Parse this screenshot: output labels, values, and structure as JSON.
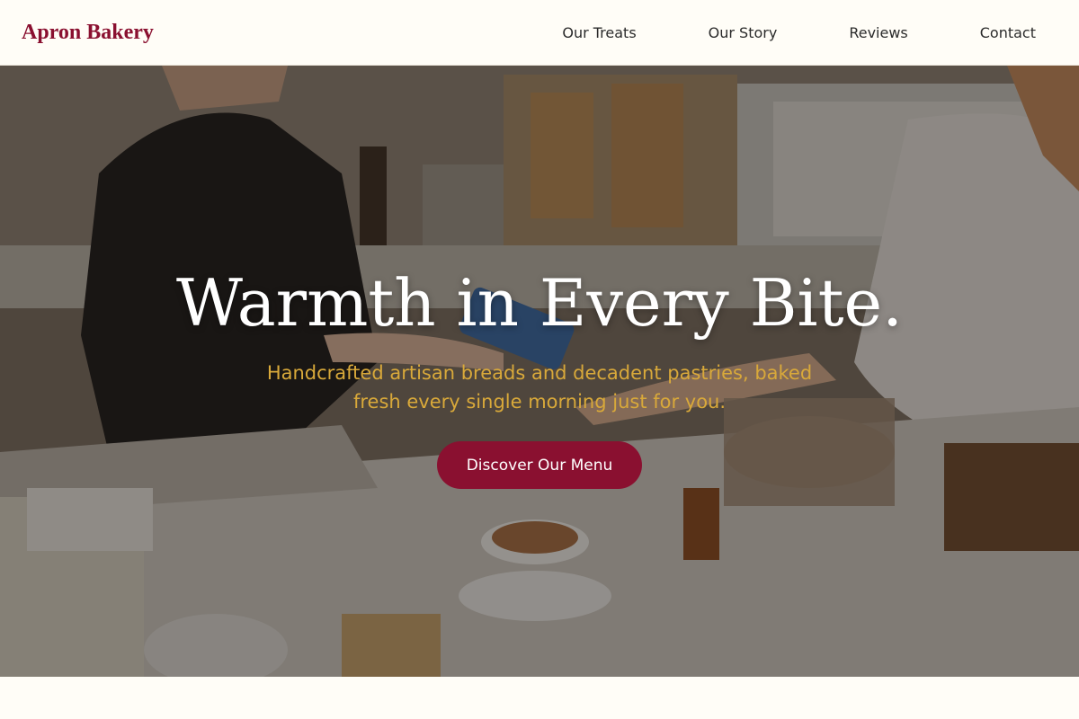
{
  "brand": {
    "name": "Apron Bakery",
    "color": "#8a1030"
  },
  "nav": {
    "items": [
      {
        "label": "Our Treats"
      },
      {
        "label": "Our Story"
      },
      {
        "label": "Reviews"
      },
      {
        "label": "Contact"
      }
    ]
  },
  "hero": {
    "title": "Warmth in Every Bite.",
    "subtitle": "Handcrafted artisan breads and decadent pastries, baked fresh every single morning just for you.",
    "cta_label": "Discover Our Menu",
    "cta_color": "#8a1030",
    "subtitle_color": "#d9a93a",
    "background_image": "bakery-counter-photo"
  }
}
